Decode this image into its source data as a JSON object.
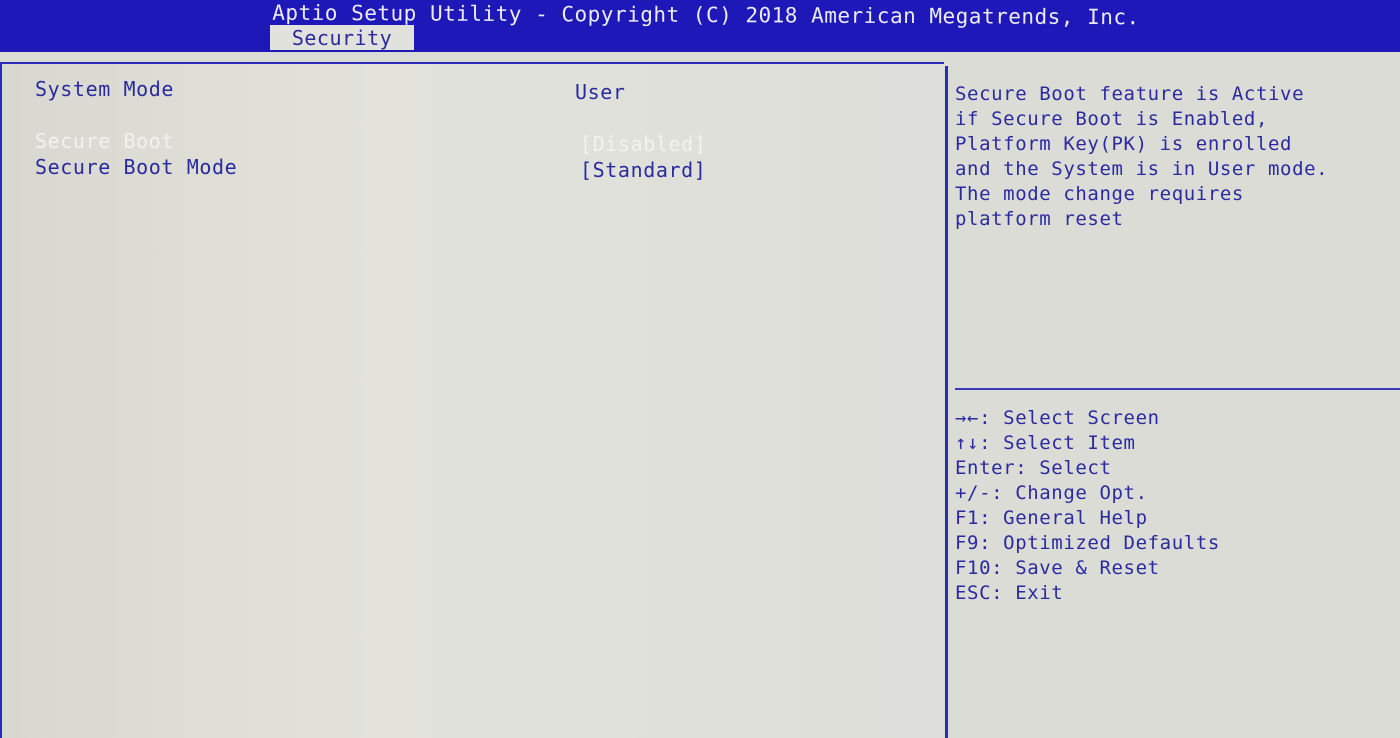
{
  "header": {
    "title": "Aptio Setup Utility - Copyright (C) 2018 American Megatrends, Inc.",
    "tabs": [
      {
        "label": "Security"
      }
    ]
  },
  "main": {
    "rows": [
      {
        "label": "System Mode",
        "value": "User"
      },
      {
        "label": "Secure Boot",
        "value": "[Disabled]"
      },
      {
        "label": "Secure Boot Mode",
        "value": "[Standard]"
      }
    ]
  },
  "help": {
    "lines": [
      "Secure Boot feature is Active",
      "if Secure Boot is Enabled,",
      "Platform Key(PK) is enrolled",
      "and the System is in User mode.",
      "The mode change requires",
      "platform reset"
    ]
  },
  "keys": {
    "lines": [
      "→←: Select Screen",
      "↑↓: Select Item",
      "Enter: Select",
      "+/-: Change Opt.",
      "F1: General Help",
      "F9: Optimized Defaults",
      "F10: Save & Reset",
      "ESC: Exit"
    ]
  },
  "colors": {
    "header_bg": "#1e18b8",
    "panel_bg": "#dcdcd6",
    "text": "#2a2aa0",
    "highlight_text": "#f2f2ee"
  }
}
